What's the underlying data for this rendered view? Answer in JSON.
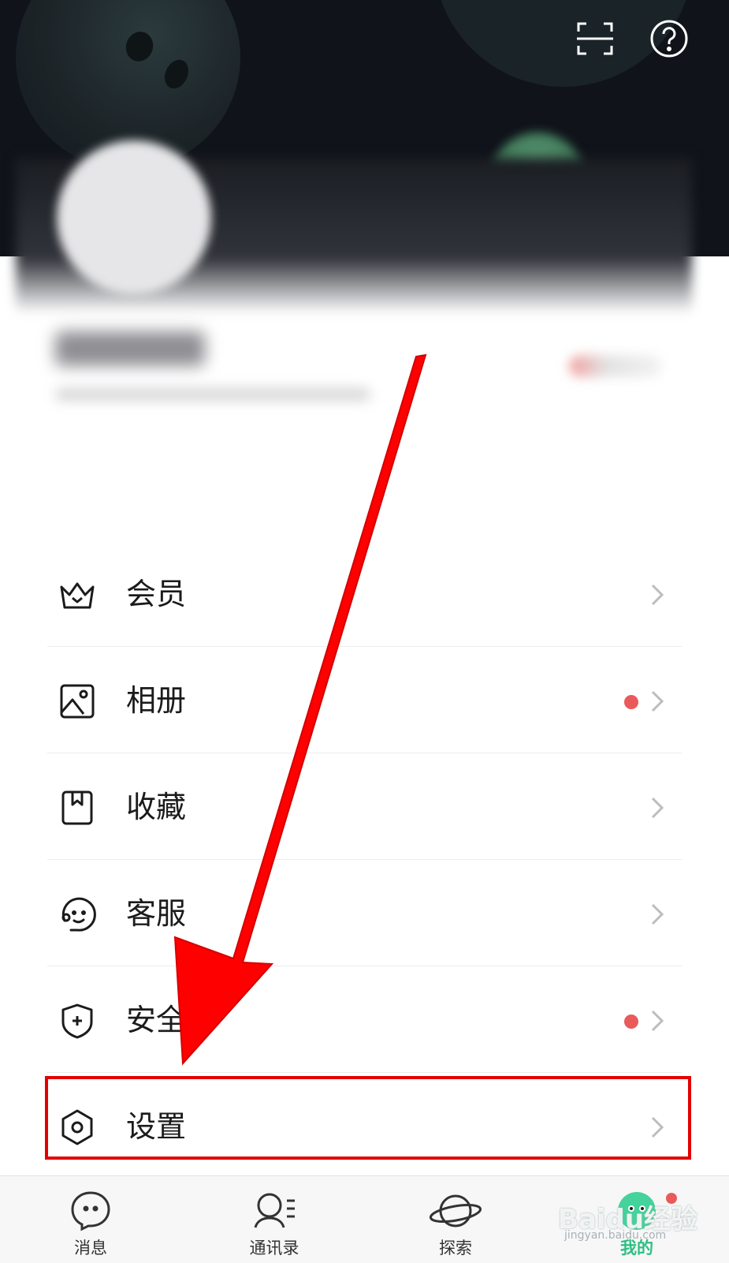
{
  "menu": {
    "items": [
      {
        "label": "会员",
        "icon": "crown-icon",
        "dot": false
      },
      {
        "label": "相册",
        "icon": "image-icon",
        "dot": true
      },
      {
        "label": "收藏",
        "icon": "bookmark-icon",
        "dot": false
      },
      {
        "label": "客服",
        "icon": "customer-service-icon",
        "dot": false
      },
      {
        "label": "安全",
        "icon": "shield-plus-icon",
        "dot": true
      },
      {
        "label": "设置",
        "icon": "hexagon-gear-icon",
        "dot": false
      }
    ]
  },
  "tabs": [
    {
      "label": "消息",
      "icon": "chat-bubble-icon",
      "active": false
    },
    {
      "label": "通讯录",
      "icon": "contacts-icon",
      "active": false
    },
    {
      "label": "探索",
      "icon": "planet-icon",
      "active": false
    },
    {
      "label": "我的",
      "icon": "profile-mascot-icon",
      "active": true
    }
  ],
  "watermark": {
    "brand": "Baidu经验",
    "url": "jingyan.baidu.com"
  },
  "colors": {
    "accent": "#2fbf82",
    "badge": "#ea5a5a",
    "annotation": "#e30000",
    "header_bg": "#10131a"
  }
}
